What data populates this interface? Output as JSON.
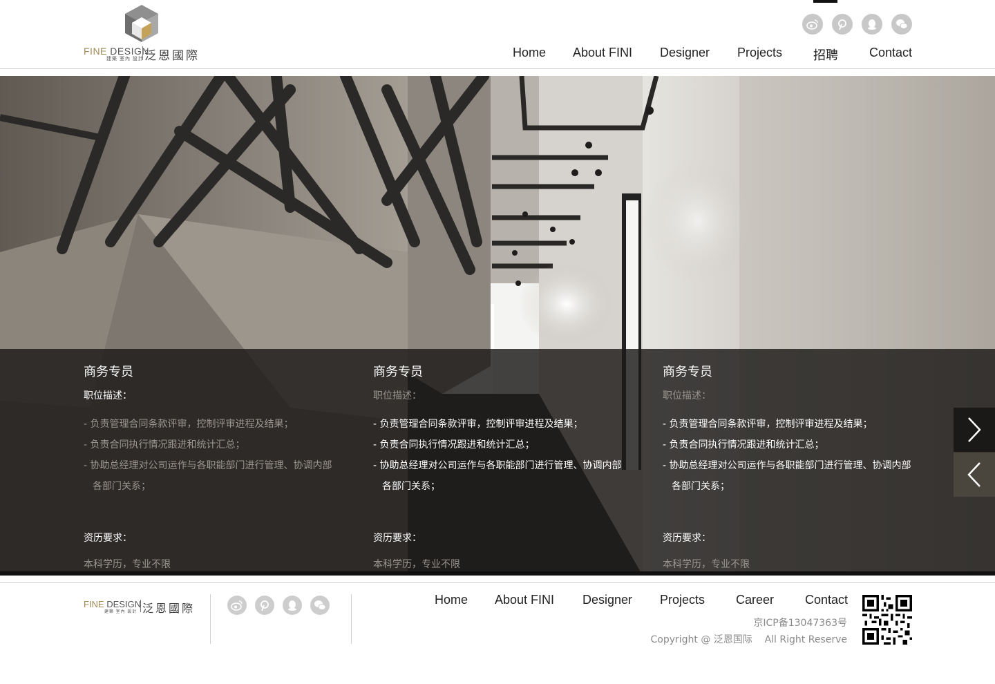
{
  "brand": {
    "logo_en_prefix": "FINE",
    "logo_en_suffix": "DESIGN",
    "logo_sub": "建築 室內 設計",
    "logo_cn": "泛恩國際"
  },
  "header": {
    "social_icons": [
      "weibo-icon",
      "pinterest-icon",
      "qq-icon",
      "wechat-icon"
    ],
    "nav": [
      "Home",
      "About FINI",
      "Designer",
      "Projects",
      "招聘",
      "Contact"
    ],
    "active_nav": "招聘"
  },
  "jobs": [
    {
      "title": "商务专员",
      "desc_label": "职位描述：",
      "items": [
        "- 负责管理合同条款评审，控制评审进程及结果；",
        "- 负责合同执行情况跟进和统计汇总；",
        "- 协助总经理对公司运作与各职能部门进行管理、协调内部各部门关系；"
      ],
      "req_label": "资历要求：",
      "req": "本科学历，专业不限"
    },
    {
      "title": "商务专员",
      "desc_label": "职位描述：",
      "items": [
        "- 负责管理合同条款评审，控制评审进程及结果；",
        "- 负责合同执行情况跟进和统计汇总；",
        "- 协助总经理对公司运作与各职能部门进行管理、协调内部各部门关系；"
      ],
      "req_label": "资历要求：",
      "req": "本科学历，专业不限"
    },
    {
      "title": "商务专员",
      "desc_label": "职位描述：",
      "items": [
        "- 负责管理合同条款评审，控制评审进程及结果；",
        "- 负责合同执行情况跟进和统计汇总；",
        "- 协助总经理对公司运作与各职能部门进行管理、协调内部各部门关系；"
      ],
      "req_label": "资历要求：",
      "req": "本科学历，专业不限"
    }
  ],
  "carousel": {
    "next_icon": "chevron-right-icon",
    "prev_icon": "chevron-left-icon"
  },
  "footer": {
    "nav": [
      "Home",
      "About FINI",
      "Designer",
      "Projects",
      "Career",
      "Contact"
    ],
    "icp": "京ICP备13047363号",
    "copyright": "Copyright @ 泛恩国际    All Right Reserve",
    "qr_icon": "qr-code-icon"
  },
  "colors": {
    "panel_bg": "#1c1a18",
    "muted_text": "#9a9590",
    "social_icon_bg": "#c8c8c8",
    "prev_button_bg": "#4a463d",
    "logo_gold": "#a08b55"
  }
}
